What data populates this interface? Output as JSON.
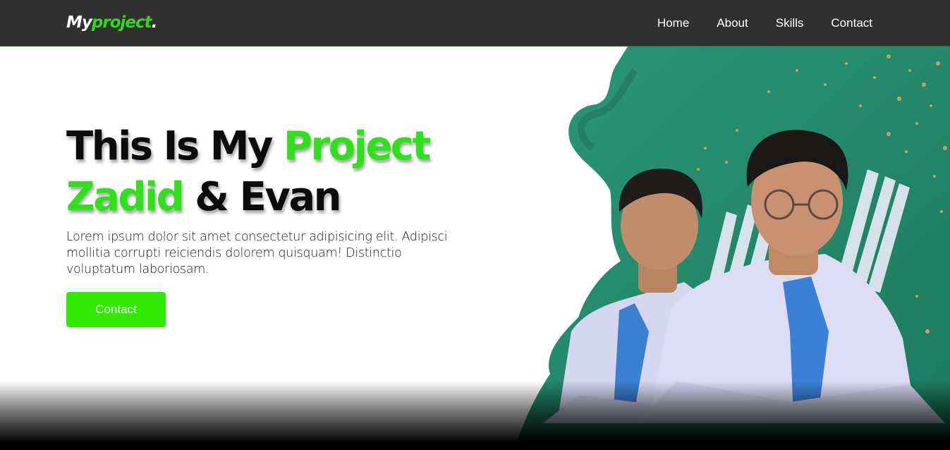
{
  "header": {
    "logo_main": "My",
    "logo_accent": "project",
    "logo_dot": ".",
    "nav": [
      {
        "label": "Home"
      },
      {
        "label": "About"
      },
      {
        "label": "Skills"
      },
      {
        "label": "Contact"
      }
    ]
  },
  "hero": {
    "title_part1": "This Is My ",
    "title_accent1": "Project",
    "title_accent2": "Zadid",
    "title_part2": " & Evan",
    "description": "Lorem ipsum dolor sit amet consectetur adipisicing elit. Adipisci mollitia corrupti reiciendis dolorem quisquam! Distinctio voluptatum laboriosam.",
    "cta_label": "Contact"
  },
  "colors": {
    "accent": "#2fe01b",
    "button": "#33ea06",
    "navbar": "#1e1e1e",
    "splash": "#238a6a"
  }
}
